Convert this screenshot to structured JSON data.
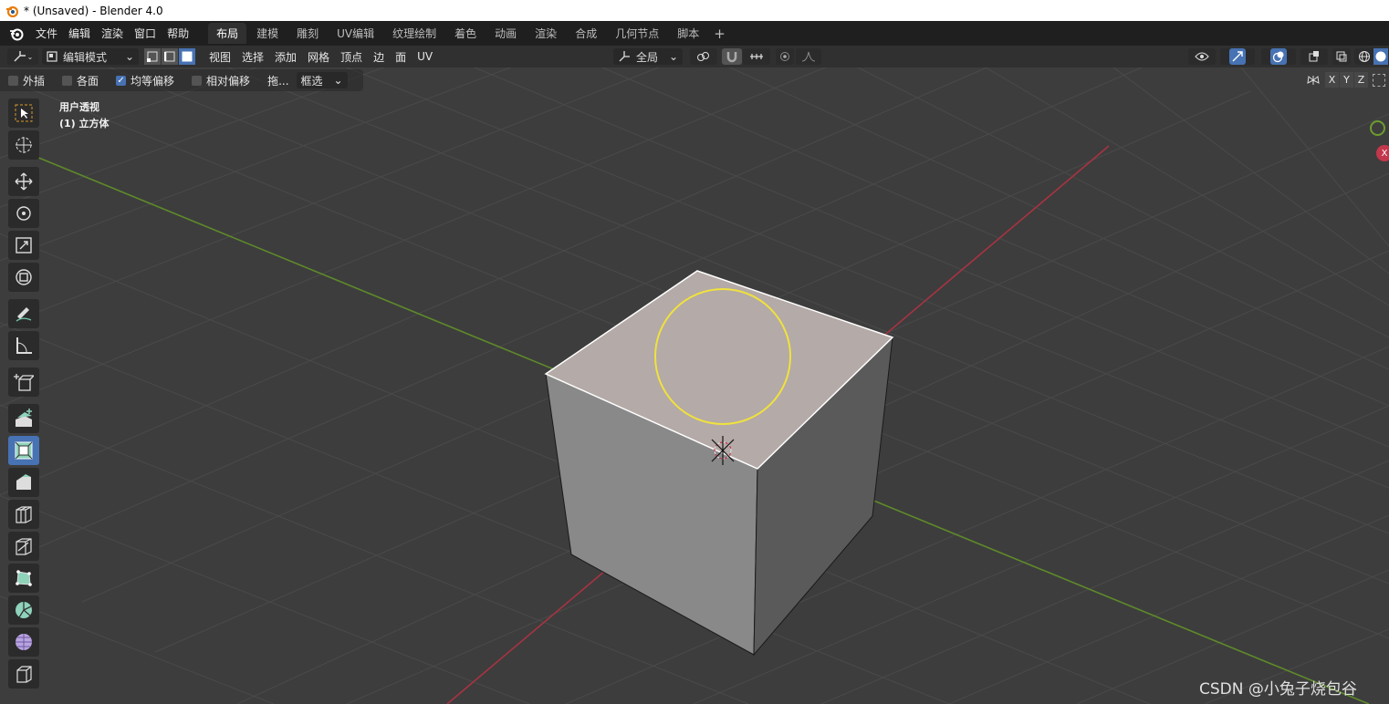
{
  "window": {
    "title": "* (Unsaved) - Blender 4.0"
  },
  "menus": [
    "文件",
    "编辑",
    "渲染",
    "窗口",
    "帮助"
  ],
  "workspaces": [
    {
      "label": "布局",
      "active": true
    },
    {
      "label": "建模"
    },
    {
      "label": "雕刻"
    },
    {
      "label": "UV编辑"
    },
    {
      "label": "纹理绘制"
    },
    {
      "label": "着色"
    },
    {
      "label": "动画"
    },
    {
      "label": "渲染"
    },
    {
      "label": "合成"
    },
    {
      "label": "几何节点"
    },
    {
      "label": "脚本"
    }
  ],
  "header": {
    "mode": "编辑模式",
    "menus": [
      "视图",
      "选择",
      "添加",
      "网格",
      "顶点",
      "边",
      "面",
      "UV"
    ],
    "orientation": "全局"
  },
  "tool_options": {
    "extrapolate": {
      "label": "外插",
      "checked": false
    },
    "individual": {
      "label": "各面",
      "checked": false
    },
    "even_offset": {
      "label": "均等偏移",
      "checked": true
    },
    "relative_offset": {
      "label": "相对偏移",
      "checked": false
    },
    "drag": "拖...",
    "select_box": "框选"
  },
  "axis_toggles": [
    "X",
    "Y",
    "Z"
  ],
  "viewport": {
    "view_name": "用户透视",
    "object_name": "(1) 立方体",
    "gizmo_axis_label": "X"
  },
  "watermark": "CSDN @小兔子烧包谷",
  "colors": {
    "accent": "#4772b3",
    "x_axis": "#c3374c",
    "y_axis": "#6d9c2e",
    "selected_face": "#b4aaa7",
    "circle": "#f0e23c"
  }
}
